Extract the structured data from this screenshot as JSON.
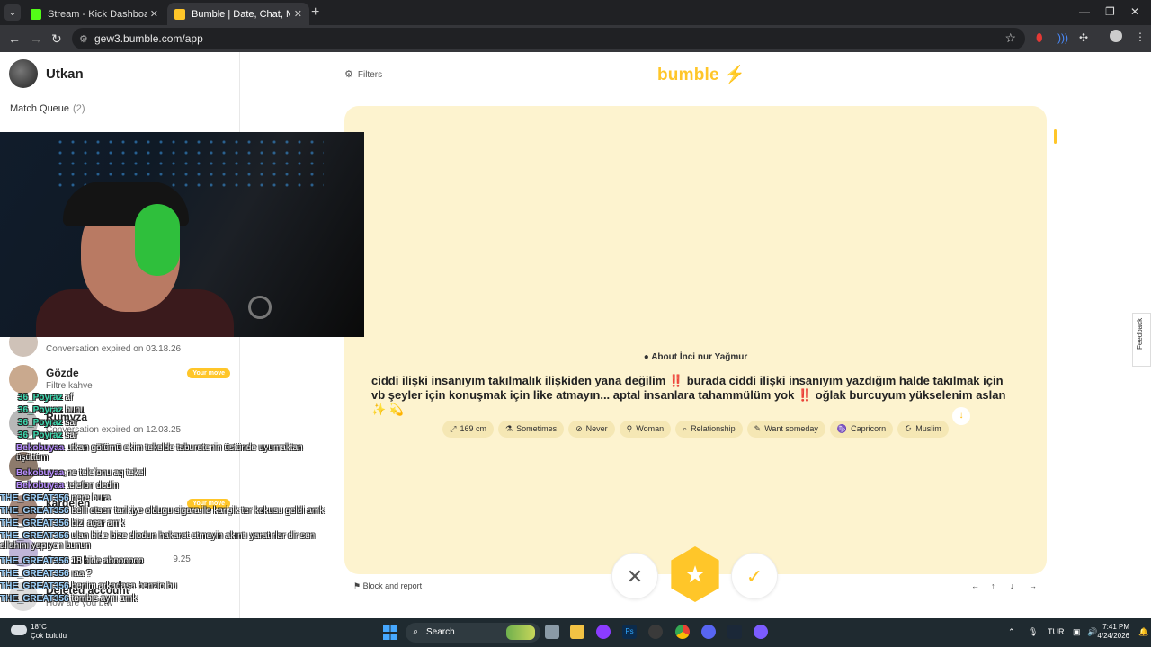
{
  "browser": {
    "tabs": [
      {
        "title": "Stream - Kick Dashboard",
        "favicon_color": "#53fc18"
      },
      {
        "title": "Bumble | Date, Chat, Meet New",
        "favicon_color": "#ffc629"
      }
    ],
    "url": "gew3.bumble.com/app"
  },
  "sidebar": {
    "user_name": "Utkan",
    "match_queue_label": "Match Queue",
    "match_queue_count": "(2)",
    "conversations": [
      {
        "name": "",
        "subtitle": "Conversation expired on 03.18.26",
        "badge": ""
      },
      {
        "name": "Gözde",
        "subtitle": "Filtre kahve",
        "badge": "Your move"
      },
      {
        "name": "Rumyza",
        "subtitle": "Conversation expired on 12.03.25",
        "badge": ""
      },
      {
        "name": "",
        "subtitle": "Hang",
        "badge": ""
      },
      {
        "name": "kardelen",
        "subtitle": "",
        "badge": "Your move"
      },
      {
        "name": "",
        "subtitle": "Conv",
        "badge": "",
        "trailing": "9.25"
      },
      {
        "name": "Deleted account",
        "subtitle": "How are you btw",
        "badge": ""
      }
    ]
  },
  "stream_chat": [
    {
      "user": "36_Poyraz",
      "msg": "af",
      "color": "#3ddbb0"
    },
    {
      "user": "36_Poyraz",
      "msg": "bunu",
      "color": "#3ddbb0"
    },
    {
      "user": "36_Poyraz",
      "msg": "sar",
      "color": "#3ddbb0"
    },
    {
      "user": "36_Poyraz",
      "msg": "sar",
      "color": "#3ddbb0"
    },
    {
      "user": "Bekobuyaa",
      "msg": "utkan götümü ekim tekelde taburetenin üstünde uyumaktan üşüttüm",
      "color": "#b88cff"
    },
    {
      "user": "Bekobuyaa",
      "msg": "ne telefonu aq tekel",
      "color": "#b88cff"
    },
    {
      "user": "Bekobuyaa",
      "msg": "telefon dedin",
      "color": "#b88cff"
    },
    {
      "user": "THE_GREAT356",
      "msg": "nere bura",
      "color": "#9fd4ff"
    },
    {
      "user": "THE_GREAT356",
      "msg": "belli etsen tarikiye oldugu sigara ile karişik ter kokusu geldi amk",
      "color": "#9fd4ff"
    },
    {
      "user": "THE_GREAT356",
      "msg": "bizi açar amk",
      "color": "#9fd4ff"
    },
    {
      "user": "THE_GREAT356",
      "msg": "ulan bide bize diodun hakaret etmeyin akıntı yaratırlar dir sen allahını yapıyon bunun",
      "color": "#9fd4ff"
    },
    {
      "user": "THE_GREAT356",
      "msg": "18 bide aboooooo",
      "color": "#9fd4ff"
    },
    {
      "user": "THE_GREAT356",
      "msg": "ıaa ?",
      "color": "#9fd4ff"
    },
    {
      "user": "THE_GREAT356",
      "msg": "benim arkadaşa benzio bu",
      "color": "#9fd4ff"
    },
    {
      "user": "THE_GREAT356",
      "msg": "tombis aynı amk",
      "color": "#9fd4ff"
    }
  ],
  "main": {
    "filters_label": "Filters",
    "brand": "bumble",
    "about_title": "About İnci nur Yağmur",
    "bio": "ciddi ilişki insanıyım takılmalık ilişkiden yana değilim ‼️ burada ciddi ilişki insanıyım yazdığım halde takılmak için vb şeyler için konuşmak için like atmayın... aptal insanlara tahammülüm yok ‼️ oğlak burcuyum yükselenim aslan ✨ 💫",
    "tags": [
      {
        "icon": "⤢",
        "label": "169 cm"
      },
      {
        "icon": "⚗",
        "label": "Sometimes"
      },
      {
        "icon": "⊘",
        "label": "Never"
      },
      {
        "icon": "⚲",
        "label": "Woman"
      },
      {
        "icon": "⌕",
        "label": "Relationship"
      },
      {
        "icon": "✎",
        "label": "Want someday"
      },
      {
        "icon": "♑",
        "label": "Capricorn"
      },
      {
        "icon": "☪",
        "label": "Muslim"
      }
    ],
    "block_label": "Block and report",
    "arrow_hints": [
      "←",
      "↑",
      "↓",
      "→"
    ]
  },
  "feedback_label": "Feedback",
  "taskbar": {
    "temperature": "18°C",
    "weather_text": "Çok bulutlu",
    "search_label": "Search",
    "language": "TUR",
    "time": "7:41 PM",
    "date": "4/24/2026"
  }
}
